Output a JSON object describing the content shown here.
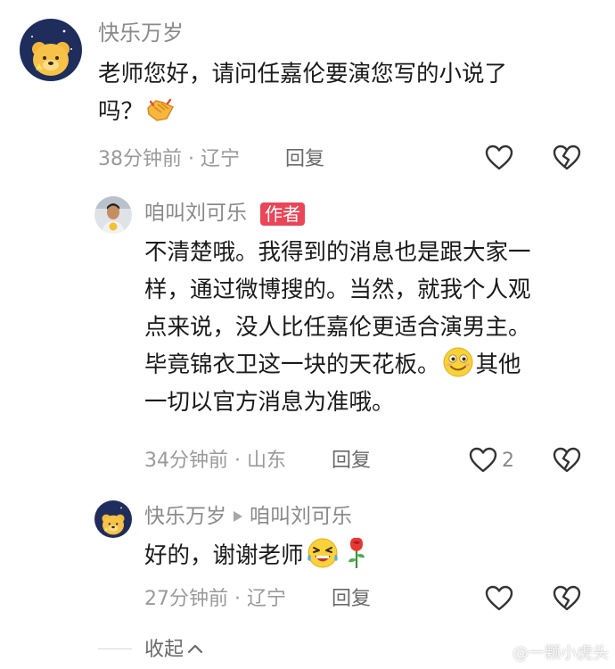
{
  "colors": {
    "text_primary": "#1a1a1a",
    "text_secondary": "#8a8a8a",
    "author_tag_bg": "#ea4658"
  },
  "comment1": {
    "username": "快乐万岁",
    "avatar_icon": "winnie-the-pooh-avatar",
    "lines": [
      "老师您好，请问任嘉伦要演您写的小说了",
      "吗？"
    ],
    "emoji": "handshake-emoji",
    "time_location": "38分钟前 · 辽宁",
    "reply_label": "回复",
    "like_count": ""
  },
  "comment2": {
    "username": "咱叫刘可乐",
    "author_tag": "作者",
    "avatar_icon": "man-portrait-avatar",
    "lines": [
      "不清楚哦。我得到的消息也是跟大家一",
      "样，通过微博搜的。当然，就我个人观",
      "点来说，没人比任嘉伦更适合演男主。",
      "毕竟锦衣卫这一块的天花板。",
      "其他",
      "一切以官方消息为准哦。"
    ],
    "emoji": "grinning-face-emoji",
    "time_location": "34分钟前 · 山东",
    "reply_label": "回复",
    "like_count": "2"
  },
  "comment3": {
    "username": "快乐万岁",
    "reply_to": "咱叫刘可乐",
    "avatar_icon": "winnie-the-pooh-avatar",
    "text": "好的，谢谢老师",
    "emojis": [
      "laughing-face-emoji",
      "rose-emoji"
    ],
    "time_location": "27分钟前 · 辽宁",
    "reply_label": "回复",
    "like_count": ""
  },
  "footer": {
    "collapse_label": "收起"
  },
  "watermark": {
    "text": "@一颗小虎头"
  }
}
